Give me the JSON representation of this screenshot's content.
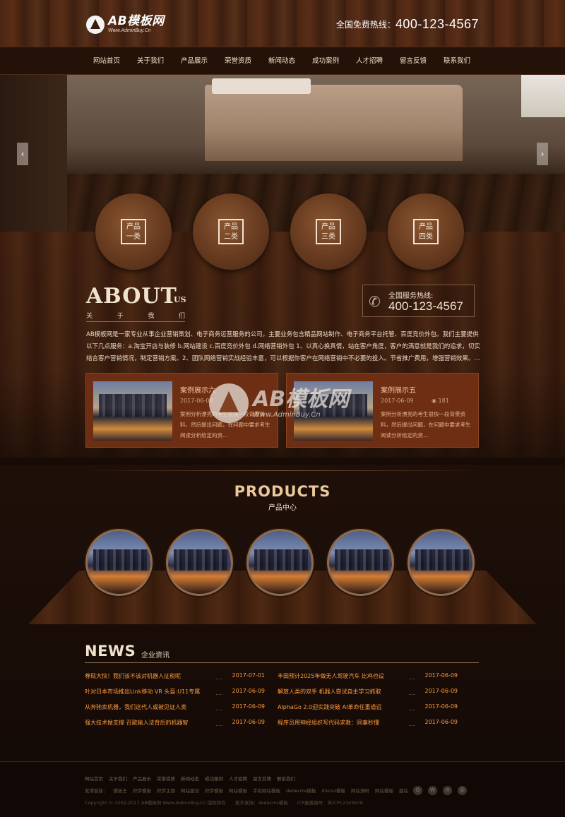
{
  "header": {
    "logo_main": "AB模板网",
    "logo_sub": "Www.AdminBuy.Cn",
    "hotline_label": "全国免费热线：",
    "hotline_number": "400-123-4567"
  },
  "nav": [
    "网站首页",
    "关于我们",
    "产品展示",
    "荣誉资质",
    "新闻动态",
    "成功案例",
    "人才招聘",
    "留言反馈",
    "联系我们"
  ],
  "banner": {
    "prev_icon": "chevron-left-icon",
    "next_icon": "chevron-right-icon"
  },
  "categories": [
    {
      "line1": "产品",
      "line2": "一类"
    },
    {
      "line1": "产品",
      "line2": "二类"
    },
    {
      "line1": "产品",
      "line2": "三类"
    },
    {
      "line1": "产品",
      "line2": "四类"
    }
  ],
  "about": {
    "title": "ABOUT",
    "title_small": "US",
    "sub_chars": [
      "关",
      "于",
      "我",
      "们"
    ],
    "hot_label": "全国服务热线:",
    "hot_number": "400-123-4567",
    "text": "AB模板网是一家专业从事企业营销策划、电子商务运营服务的公司，主要业务包含精品网站制作、电子商务平台托管、百度竞价外包。我们主要提供以下几点服务：a.淘宝开店与装修 b.网站建设 c.百度竞价外包 d.网络营销外包 1、以真心换真情，站在客户角度，客户的满意就是我们的追求，切实结合客户营销情况，制定营销方案。2、团队网络营销实战经验丰富，可以根据你客户在网络营销中不必要的投入。节省推广费用，增强营销效果。..."
  },
  "cases": [
    {
      "title": "案例展示六",
      "date": "2017-06-09",
      "views": "",
      "text": "案例分析漂亮的考生很快一段背景资料，然后提出问题，在问题中要求考生阅读分析给定的资..."
    },
    {
      "title": "案例展示五",
      "date": "2017-06-09",
      "views": "181",
      "text": "案例分析漂亮的考生很快一段背景资料，然后提出问题，在问题中要求考生阅读分析给定的资..."
    }
  ],
  "watermark": {
    "main": "AB模板网",
    "sub": "Www.AdminBuy.Cn"
  },
  "products": {
    "title": "PRODUCTS",
    "subtitle": "产品中心",
    "count": 5
  },
  "news": {
    "title": "NEWS",
    "subtitle": "企业资讯",
    "left": [
      {
        "t": "尊现大快！我们该不该对机器人征税呢",
        "d": "2017-07-01"
      },
      {
        "t": "叶对日本市场推出Link移动 VR 头盔:U11专属",
        "d": "2017-06-09"
      },
      {
        "t": "从奔驰卖机器，我们这代人或被见证人类",
        "d": "2017-06-09"
      },
      {
        "t": "强大技术做支撑 召歌输入法背后的机器智",
        "d": "2017-06-09"
      }
    ],
    "right": [
      {
        "t": "丰田预计2025年做无人驾驶汽车 比鸡也设",
        "d": "2017-06-09"
      },
      {
        "t": "解放人类的双手 机器人尝试自主学习抓取",
        "d": "2017-06-09"
      },
      {
        "t": "AlphaGo 2.0迎实践突破 AI革命任重道远",
        "d": "2017-06-09"
      },
      {
        "t": "程序员用神经组织写代码求救：同事秒懂",
        "d": "2017-06-09"
      }
    ]
  },
  "footer": {
    "nav": [
      "网站首页",
      "关于我们",
      "产品展示",
      "荣誉资质",
      "新闻动态",
      "成功案例",
      "人才招聘",
      "留言反馈",
      "联系我们"
    ],
    "links": [
      "友情链接：",
      "模板王",
      "织梦模板",
      "织梦主题",
      "网站建设",
      "织梦模板",
      "网站模板",
      "手机网站模板",
      "dedecms模板",
      "discuz模板",
      "网站源码",
      "网站模板",
      "建站"
    ],
    "copyright": "Copyright © 2002-2017 AB模板网 Www.AdminBuy.Cn 版权所有　　技术支持：dedecms模板　　ICP备案编号：苏ICP12345678",
    "icons": [
      "qq-icon",
      "weibo-icon",
      "wechat-icon",
      "email-icon"
    ]
  }
}
